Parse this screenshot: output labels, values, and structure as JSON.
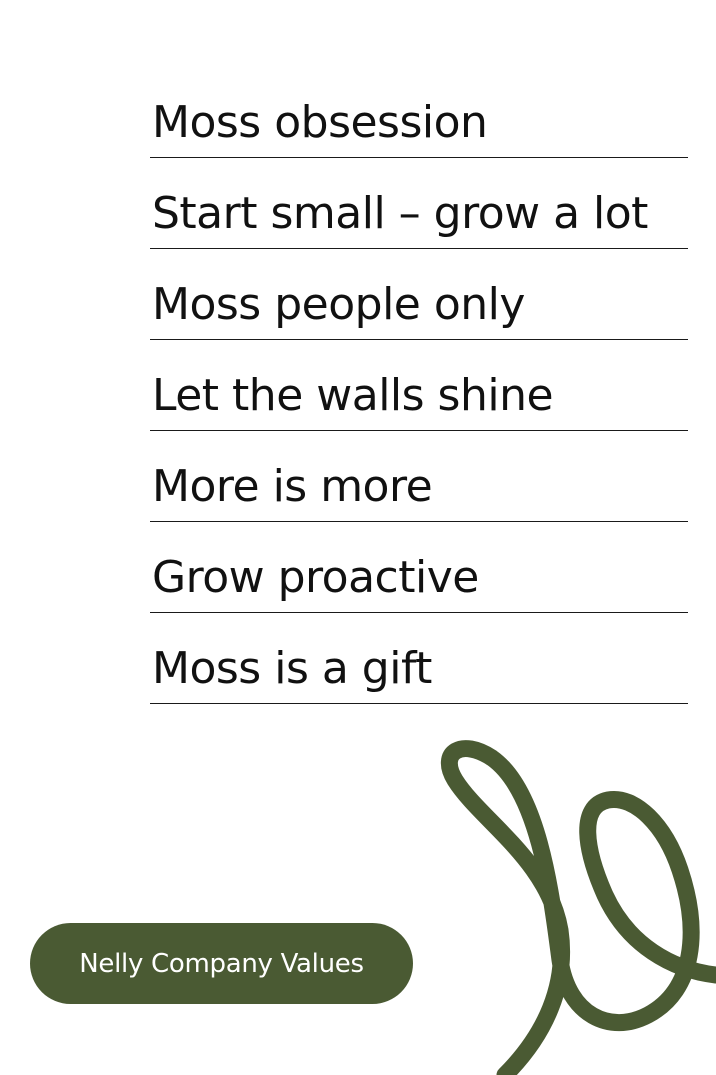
{
  "values": [
    "Moss obsession",
    "Start small – grow a lot",
    "Moss people only",
    "Let the walls shine",
    "More is more",
    "Grow proactive",
    "Moss is a gift"
  ],
  "badge": {
    "label": "Nelly Company Values"
  },
  "colors": {
    "accent": "#4a5a33",
    "text": "#111111",
    "background": "#ffffff"
  },
  "decoration": {
    "swirl_icon": "swirl-line"
  }
}
